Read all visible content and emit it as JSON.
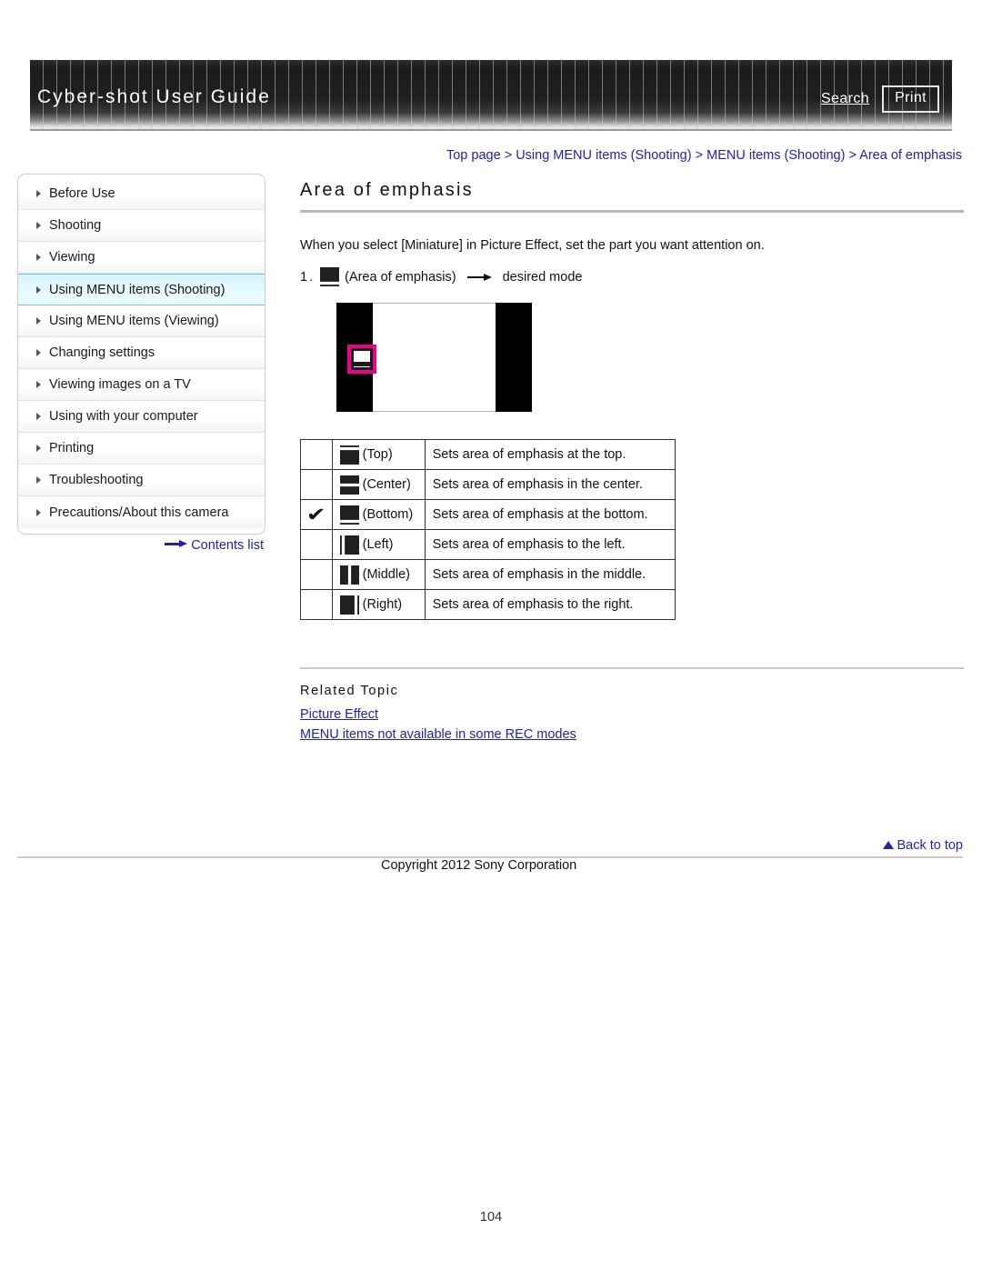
{
  "header": {
    "site_title": "Cyber-shot User Guide",
    "search_label": "Search",
    "print_label": "Print"
  },
  "breadcrumb": {
    "full": "Top page > Using MENU items (Shooting) > MENU items (Shooting) > Area of emphasis",
    "items": [
      "Top page",
      "Using MENU items (Shooting)",
      "MENU items (Shooting)",
      "Area of emphasis"
    ],
    "separator": ">"
  },
  "sidebar": {
    "items": [
      {
        "label": "Before Use",
        "active": false
      },
      {
        "label": "Shooting",
        "active": false
      },
      {
        "label": "Viewing",
        "active": false
      },
      {
        "label": "Using MENU items (Shooting)",
        "active": true
      },
      {
        "label": "Using MENU items (Viewing)",
        "active": false
      },
      {
        "label": "Changing settings",
        "active": false
      },
      {
        "label": "Viewing images on a TV",
        "active": false
      },
      {
        "label": "Using with your computer",
        "active": false
      },
      {
        "label": "Printing",
        "active": false
      },
      {
        "label": "Troubleshooting",
        "active": false
      },
      {
        "label": "Precautions/About this camera",
        "active": false
      }
    ],
    "contents_list_label": "Contents list",
    "active_highlight_color": "#d4f3fb",
    "active_border_color": "#63c9e4"
  },
  "main": {
    "title": "Area of emphasis",
    "intro": "When you select [Miniature] in Picture Effect, set the part you want attention on.",
    "step": {
      "number": "1.",
      "icon_label": "(Area of emphasis)",
      "target": "desired mode"
    },
    "illustration": {
      "badge_color": "#ec008c",
      "description": "Camera screen showing area-of-emphasis icon highlighted on the left"
    },
    "table": {
      "rows": [
        {
          "checked": true,
          "check": "",
          "icon": "area-top-icon",
          "mode": "(Top)",
          "description": "Sets area of emphasis at the top."
        },
        {
          "checked": false,
          "check": "",
          "icon": "area-center-icon",
          "mode": "(Center)",
          "description": "Sets area of emphasis in the center."
        },
        {
          "checked": true,
          "check": "✔",
          "icon": "area-bottom-icon",
          "mode": "(Bottom)",
          "description": "Sets area of emphasis at the bottom."
        },
        {
          "checked": false,
          "check": "",
          "icon": "area-left-icon",
          "mode": "(Left)",
          "description": "Sets area of emphasis to the left."
        },
        {
          "checked": false,
          "check": "",
          "icon": "area-middle-icon",
          "mode": "(Middle)",
          "description": "Sets area of emphasis in the middle."
        },
        {
          "checked": false,
          "check": "",
          "icon": "area-right-icon",
          "mode": "(Right)",
          "description": "Sets area of emphasis to the right."
        }
      ]
    },
    "related": {
      "heading": "Related Topic",
      "links": [
        "Picture Effect",
        "MENU items not available in some REC modes"
      ]
    }
  },
  "footer": {
    "back_to_top": "Back to top",
    "copyright": "Copyright 2012 Sony Corporation",
    "page_number": "104"
  },
  "colors": {
    "link_blue": "#2222aa",
    "accent_magenta": "#ec008c",
    "header_dark": "#1c1c1c"
  }
}
